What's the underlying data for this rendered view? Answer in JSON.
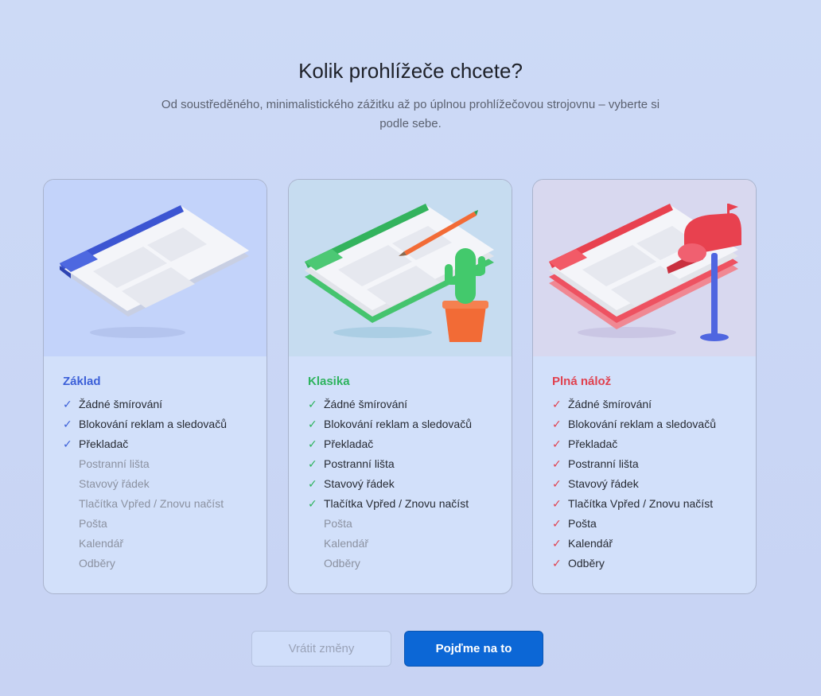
{
  "header": {
    "title": "Kolik prohlížeče chcete?",
    "subtitle": "Od soustředěného, minimalistického zážitku až po úplnou prohlížečovou strojovnu – vyberte si podle sebe."
  },
  "check_glyph": "✓",
  "colors": {
    "basic_accent": "#3b5fd8",
    "classic_accent": "#2eb35e",
    "full_accent": "#e0414f",
    "primary_button": "#0c67d6"
  },
  "cards": [
    {
      "name": "Základ",
      "illustration": "browser-window-blue",
      "features": [
        {
          "label": "Žádné šmírování",
          "enabled": true
        },
        {
          "label": "Blokování reklam a sledovačů",
          "enabled": true
        },
        {
          "label": "Překladač",
          "enabled": true
        },
        {
          "label": "Postranní lišta",
          "enabled": false
        },
        {
          "label": "Stavový řádek",
          "enabled": false
        },
        {
          "label": "Tlačítka Vpřed / Znovu načíst",
          "enabled": false
        },
        {
          "label": "Pošta",
          "enabled": false
        },
        {
          "label": "Kalendář",
          "enabled": false
        },
        {
          "label": "Odběry",
          "enabled": false
        }
      ]
    },
    {
      "name": "Klasika",
      "illustration": "browser-window-green-cactus-pencil",
      "features": [
        {
          "label": "Žádné šmírování",
          "enabled": true
        },
        {
          "label": "Blokování reklam a sledovačů",
          "enabled": true
        },
        {
          "label": "Překladač",
          "enabled": true
        },
        {
          "label": "Postranní lišta",
          "enabled": true
        },
        {
          "label": "Stavový řádek",
          "enabled": true
        },
        {
          "label": "Tlačítka Vpřed / Znovu načíst",
          "enabled": true
        },
        {
          "label": "Pošta",
          "enabled": false
        },
        {
          "label": "Kalendář",
          "enabled": false
        },
        {
          "label": "Odběry",
          "enabled": false
        }
      ]
    },
    {
      "name": "Plná nálož",
      "illustration": "browser-window-red-mailbox",
      "features": [
        {
          "label": "Žádné šmírování",
          "enabled": true
        },
        {
          "label": "Blokování reklam a sledovačů",
          "enabled": true
        },
        {
          "label": "Překladač",
          "enabled": true
        },
        {
          "label": "Postranní lišta",
          "enabled": true
        },
        {
          "label": "Stavový řádek",
          "enabled": true
        },
        {
          "label": "Tlačítka Vpřed / Znovu načíst",
          "enabled": true
        },
        {
          "label": "Pošta",
          "enabled": true
        },
        {
          "label": "Kalendář",
          "enabled": true
        },
        {
          "label": "Odběry",
          "enabled": true
        }
      ]
    }
  ],
  "buttons": {
    "revert": "Vrátit změny",
    "confirm": "Pojďme na to"
  }
}
